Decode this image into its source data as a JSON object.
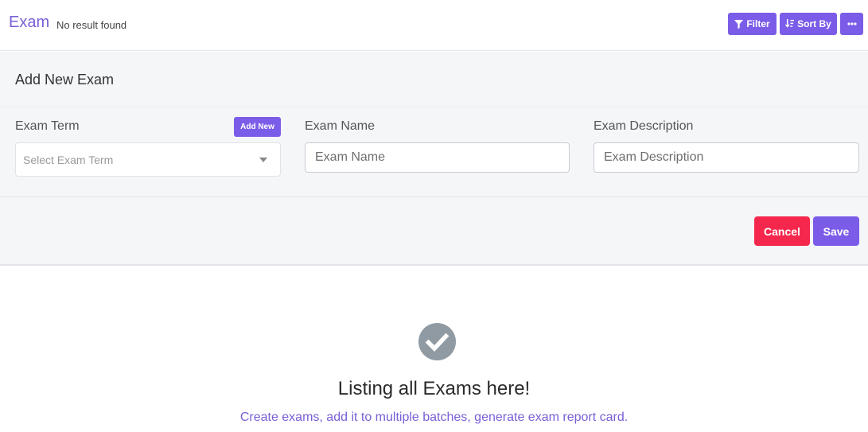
{
  "header": {
    "title": "Exam",
    "subtitle": "No result found",
    "filter_label": "Filter",
    "sort_label": "Sort By"
  },
  "form": {
    "heading": "Add New Exam",
    "exam_term": {
      "label": "Exam Term",
      "add_new_label": "Add New",
      "placeholder": "Select Exam Term"
    },
    "exam_name": {
      "label": "Exam Name",
      "placeholder": "Exam Name",
      "value": ""
    },
    "exam_description": {
      "label": "Exam Description",
      "placeholder": "Exam Description",
      "value": ""
    },
    "cancel_label": "Cancel",
    "save_label": "Save"
  },
  "empty_state": {
    "icon": "check-circle-icon",
    "title": "Listing all Exams here!",
    "description": "Create exams, add it to multiple batches, generate exam report card."
  },
  "colors": {
    "accent": "#7b5ce8",
    "danger": "#f5274d",
    "title": "#7a5fd6",
    "icon_gray": "#8f9aa3"
  }
}
